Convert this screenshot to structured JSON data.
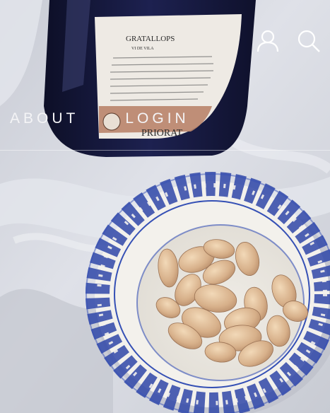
{
  "header": {
    "account_icon": "user-icon",
    "search_icon": "search-icon"
  },
  "nav": {
    "items": [
      {
        "label": "ABOUT"
      },
      {
        "label": "LOGIN"
      }
    ]
  },
  "hero_image": {
    "bottle_label": {
      "brand": "GRATALLOPS",
      "sub": "VI DE VILA",
      "region": "PRIORAT"
    }
  },
  "colors": {
    "nav_text": "#f4f4f6",
    "bottle": "#16183a",
    "bowl_blue": "#2f47a8",
    "cloth": "#d6d9e2"
  }
}
